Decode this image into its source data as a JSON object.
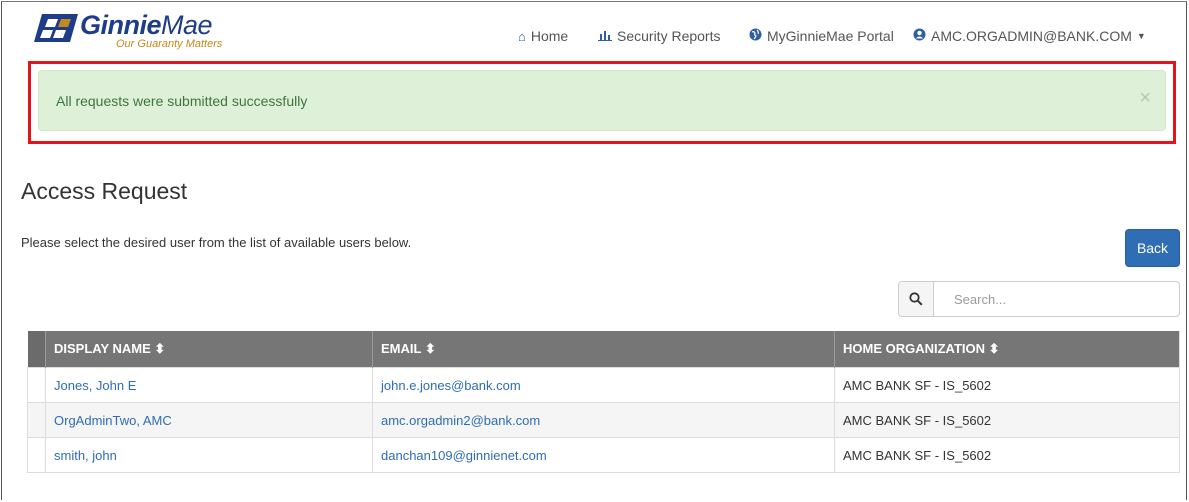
{
  "brand": {
    "name_bold": "Ginnie",
    "name_light": "Mae",
    "tagline": "Our Guaranty Matters"
  },
  "nav": {
    "home": "Home",
    "security_reports": "Security Reports",
    "portal": "MyGinnieMae Portal",
    "user": "AMC.ORGADMIN@BANK.COM"
  },
  "alert": {
    "message": "All requests were submitted successfully",
    "close": "×"
  },
  "page": {
    "title": "Access Request",
    "instructions": "Please select the desired user from the list of available users below.",
    "back_label": "Back"
  },
  "search": {
    "placeholder": "Search..."
  },
  "table": {
    "headers": [
      "DISPLAY NAME ⬍",
      "EMAIL ⬍",
      "HOME ORGANIZATION ⬍"
    ],
    "rows": [
      {
        "name": "Jones, John E",
        "email": "john.e.jones@bank.com",
        "org": "AMC BANK SF - IS_5602"
      },
      {
        "name": "OrgAdminTwo, AMC",
        "email": "amc.orgadmin2@bank.com",
        "org": "AMC BANK SF - IS_5602"
      },
      {
        "name": "smith, john",
        "email": "danchan109@ginnienet.com",
        "org": "AMC BANK SF - IS_5602"
      }
    ]
  },
  "colors": {
    "accent": "#2f6db5",
    "alert_bg": "#dff0d8",
    "alert_text": "#3c763d",
    "highlight": "#e3141b",
    "table_header": "#767676"
  }
}
